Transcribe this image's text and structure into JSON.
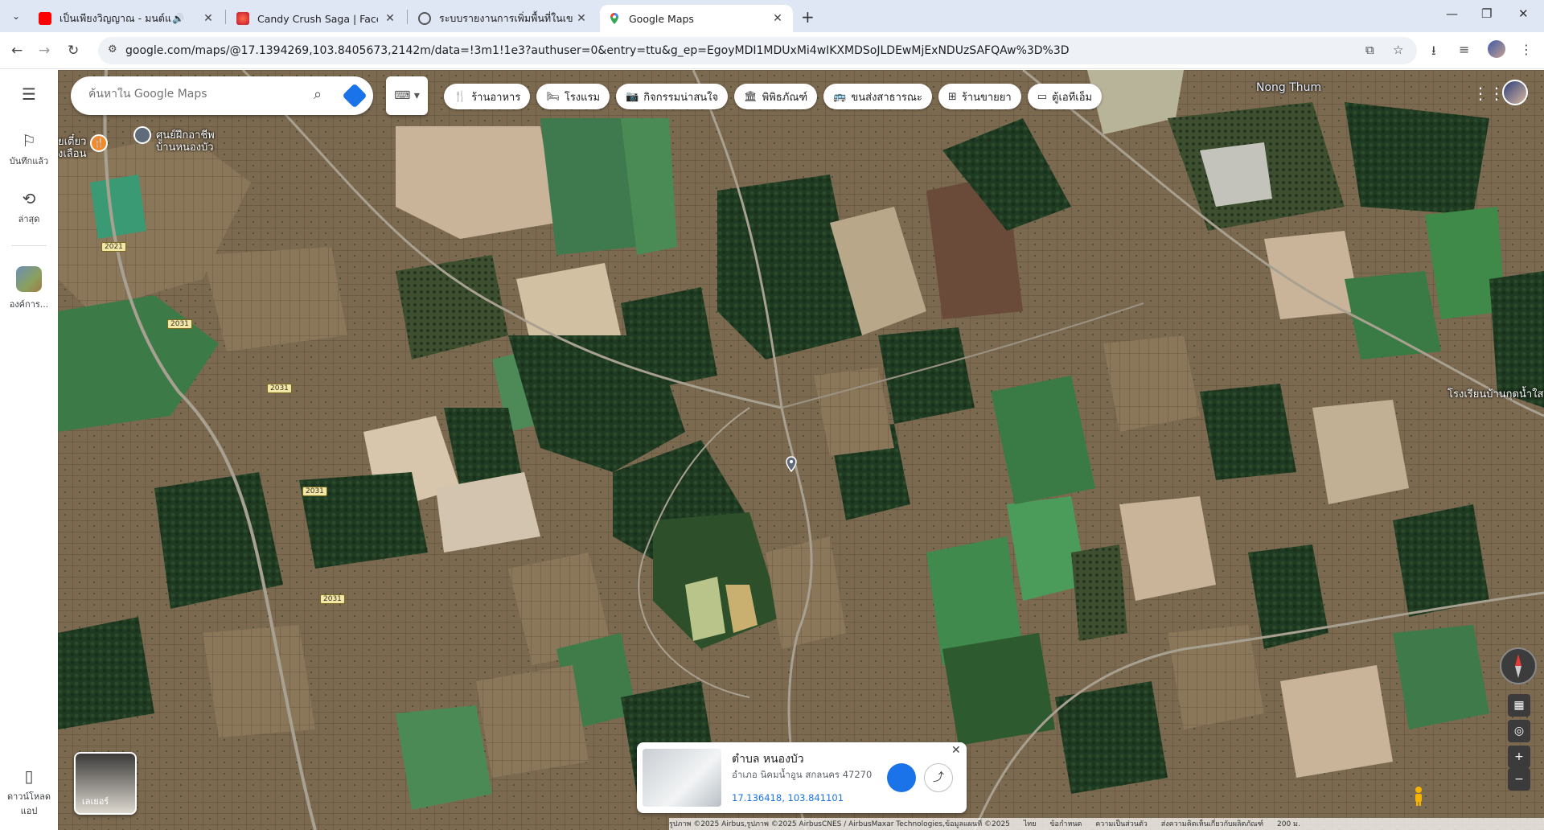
{
  "browser": {
    "tabs": [
      {
        "title": "เป็นเพียงวิญญาณ - มนต์แคน แก่นคูน",
        "favicon": "youtube",
        "audio": true
      },
      {
        "title": "Candy Crush Saga | Facebook",
        "favicon": "candy-crush"
      },
      {
        "title": "ระบบรายงานการเพิ่มพื้นที่ในเขตชุมชน",
        "favicon": "globe"
      },
      {
        "title": "Google Maps",
        "favicon": "maps-pin",
        "active": true
      }
    ],
    "url": "google.com/maps/@17.1394269,103.8405673,2142m/data=!3m1!1e3?authuser=0&entry=ttu&g_ep=EgoyMDI1MDUxMi4wIKXMDSoJLDEwMjExNDUzSAFQAw%3D%3D"
  },
  "rail": {
    "saved": "บันทึกแล้ว",
    "recent": "ล่าสุด",
    "recent_place": "องค์การ...",
    "download": "ดาวน์โหลดแอป"
  },
  "map": {
    "search_placeholder": "ค้นหาใน Google Maps",
    "chips": [
      {
        "label": "ร้านอาหาร",
        "icon": "fork-knife"
      },
      {
        "label": "โรงแรม",
        "icon": "bed"
      },
      {
        "label": "กิจกรรมน่าสนใจ",
        "icon": "camera"
      },
      {
        "label": "พิพิธภัณฑ์",
        "icon": "museum"
      },
      {
        "label": "ขนส่งสาธารณะ",
        "icon": "bus"
      },
      {
        "label": "ร้านขายยา",
        "icon": "pharmacy"
      },
      {
        "label": "ตู้เอทีเอ็ม",
        "icon": "atm"
      }
    ],
    "labels": {
      "nong_thum": "Nong Thum",
      "training_center_1": "ศูนย์ฝึกอาชีพ",
      "training_center_2": "บ้านหนองบัว",
      "restaurant_1": "ยเตี๋ยว",
      "restaurant_2": "งเลือน",
      "school": "โรงเรียนบ้านกุดน้ำใส"
    },
    "road_shields": [
      "2021",
      "2031",
      "2031",
      "2031",
      "2031"
    ],
    "layers_label": "เลเยอร์",
    "footer": {
      "copyright": "รูปภาพ ©2025 Airbus,รูปภาพ ©2025 AirbusCNES / AirbusMaxar Technologies,ข้อมูลแผนที่ ©2025",
      "thai": "ไทย",
      "terms": "ข้อกำหนด",
      "privacy": "ความเป็นส่วนตัว",
      "feedback": "ส่งความคิดเห็นเกี่ยวกับผลิตภัณฑ์",
      "scale": "200 ม."
    }
  },
  "place_card": {
    "title": "ตำบล หนองบัว",
    "subtitle": "อำเภอ นิคมน้ำอูน สกลนคร 47270",
    "coords": "17.136418, 103.841101"
  },
  "colors": {
    "accent": "#1a73e8",
    "tabstrip": "#dfe7f5",
    "poi_orange": "#f08a2c"
  }
}
